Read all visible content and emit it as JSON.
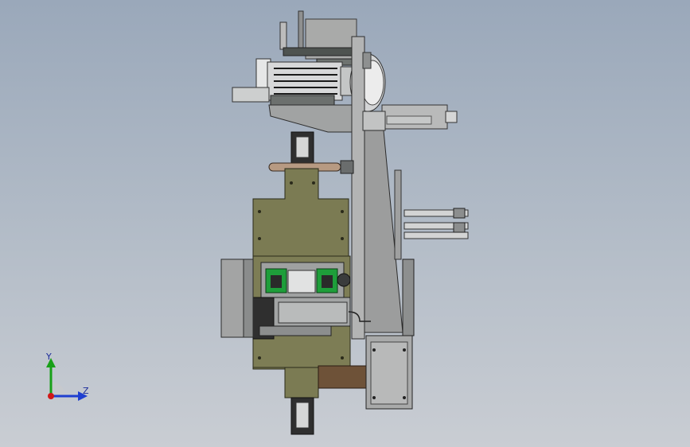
{
  "viewport": {
    "background_top": "#9aa8ba",
    "background_bottom": "#c9cdd3"
  },
  "colors": {
    "plate_olive": "#7b7b53",
    "steel_grey": "#a8a9a8",
    "dark_steel": "#5a5d60",
    "green_block": "#1e9e3a",
    "brown_block": "#6e5238",
    "cylinder_light": "#d9dadb"
  },
  "triad": {
    "y_label": "Y",
    "z_label": "Z",
    "y_color": "#18a018",
    "z_color": "#1f3fd0",
    "origin_color": "#d01818"
  }
}
